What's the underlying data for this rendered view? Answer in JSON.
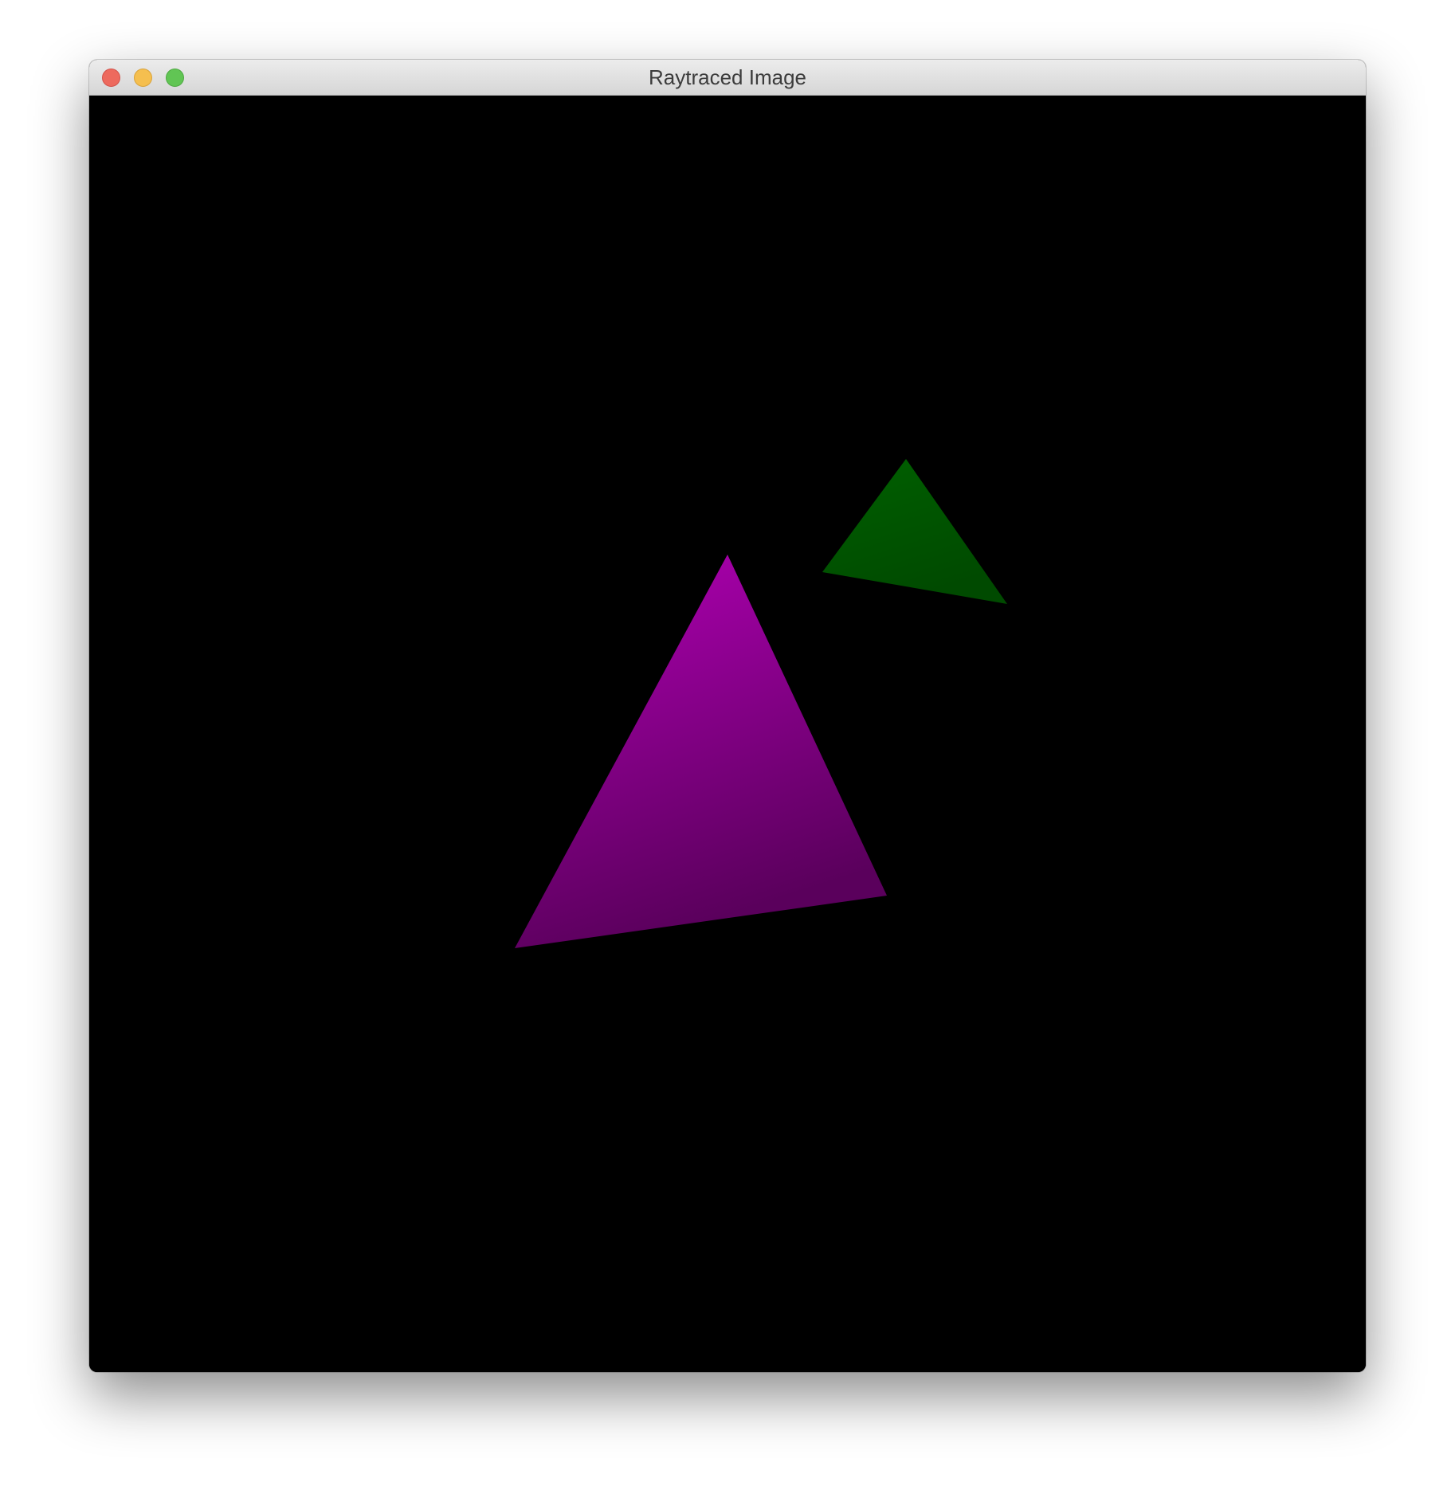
{
  "window": {
    "title": "Raytraced Image"
  },
  "controls": {
    "close": "close-button",
    "minimize": "minimize-button",
    "zoom": "zoom-button"
  },
  "scene": {
    "background_color": "#000000",
    "objects": [
      {
        "name": "magenta-triangle",
        "color_light": "#b000b3",
        "color_dark": "#5a005c"
      },
      {
        "name": "green-triangle",
        "color_light": "#006000",
        "color_dark": "#004a00"
      }
    ]
  },
  "colors": {
    "traffic_close": "#ed6a5e",
    "traffic_minimize": "#f5bf4f",
    "traffic_zoom": "#61c554"
  }
}
